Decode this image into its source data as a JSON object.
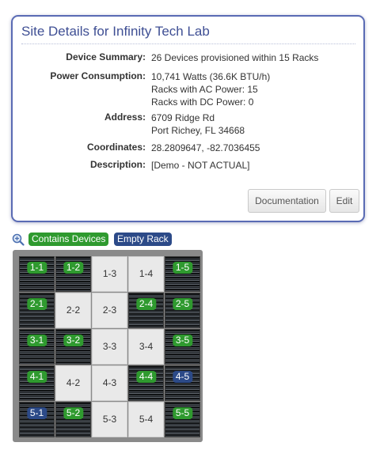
{
  "card": {
    "title": "Site Details for Infinity Tech Lab",
    "fields": [
      {
        "label": "Device Summary:",
        "lines": [
          "26 Devices provisioned within 15 Racks"
        ]
      },
      {
        "label": "Power Consumption:",
        "lines": [
          "10,741 Watts (36.6K BTU/h)",
          "Racks with AC Power: 15",
          "Racks with DC Power: 0"
        ]
      },
      {
        "label": "Address:",
        "lines": [
          "6709 Ridge Rd",
          "Port Richey, FL 34668"
        ]
      },
      {
        "label": "Coordinates:",
        "lines": [
          "28.2809647, -82.7036455"
        ]
      },
      {
        "label": "Description:",
        "lines": [
          "[Demo - NOT ACTUAL]"
        ]
      }
    ],
    "buttons": {
      "documentation": "Documentation",
      "edit": "Edit"
    }
  },
  "legend": {
    "contains_devices": "Contains Devices",
    "empty_rack": "Empty Rack",
    "zoom_icon": "zoom-in-icon"
  },
  "colors": {
    "contains_devices": "#2f9a2f",
    "empty_rack": "#2c4a88",
    "title": "#3f4f94",
    "card_border": "#5a6bb4"
  },
  "rack_grid": {
    "rows": [
      [
        {
          "label": "1-1",
          "state": "contains"
        },
        {
          "label": "1-2",
          "state": "contains"
        },
        {
          "label": "1-3",
          "state": "none"
        },
        {
          "label": "1-4",
          "state": "none"
        },
        {
          "label": "1-5",
          "state": "contains"
        }
      ],
      [
        {
          "label": "2-1",
          "state": "contains"
        },
        {
          "label": "2-2",
          "state": "none"
        },
        {
          "label": "2-3",
          "state": "none"
        },
        {
          "label": "2-4",
          "state": "contains"
        },
        {
          "label": "2-5",
          "state": "contains"
        }
      ],
      [
        {
          "label": "3-1",
          "state": "contains"
        },
        {
          "label": "3-2",
          "state": "contains"
        },
        {
          "label": "3-3",
          "state": "none"
        },
        {
          "label": "3-4",
          "state": "none"
        },
        {
          "label": "3-5",
          "state": "contains"
        }
      ],
      [
        {
          "label": "4-1",
          "state": "contains"
        },
        {
          "label": "4-2",
          "state": "none"
        },
        {
          "label": "4-3",
          "state": "none"
        },
        {
          "label": "4-4",
          "state": "contains"
        },
        {
          "label": "4-5",
          "state": "empty_rack"
        }
      ],
      [
        {
          "label": "5-1",
          "state": "empty_rack"
        },
        {
          "label": "5-2",
          "state": "contains"
        },
        {
          "label": "5-3",
          "state": "none"
        },
        {
          "label": "5-4",
          "state": "none"
        },
        {
          "label": "5-5",
          "state": "contains"
        }
      ]
    ]
  }
}
